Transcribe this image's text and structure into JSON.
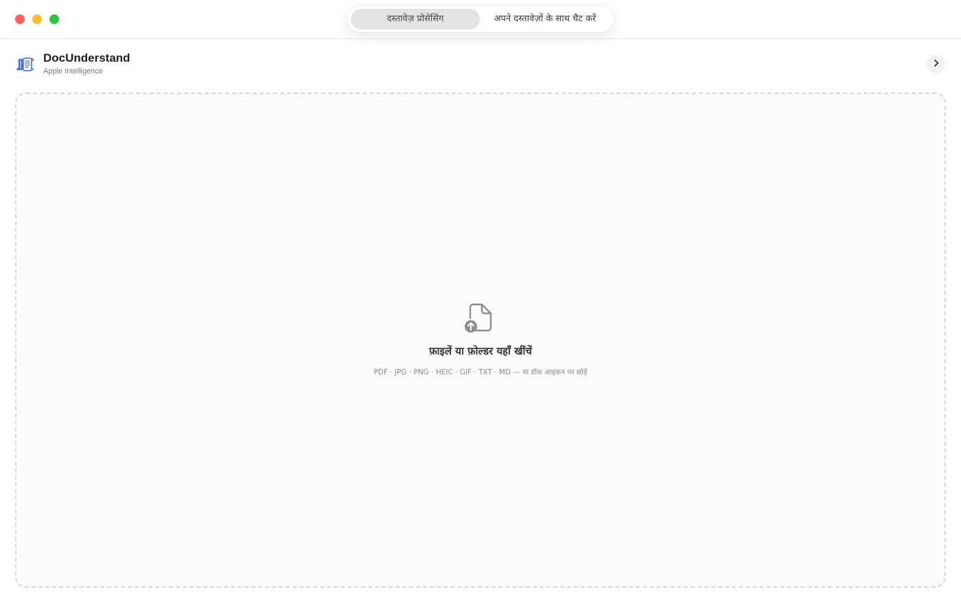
{
  "window": {
    "controls": {
      "close": "close",
      "minimize": "minimize",
      "maximize": "maximize"
    }
  },
  "tabs": [
    {
      "label": "दस्तावेज़ प्रोसेसिंग",
      "active": true
    },
    {
      "label": "अपने दस्तावेज़ों के साथ चैट करें",
      "active": false
    }
  ],
  "app": {
    "name": "DocUnderstand",
    "subtitle": "Apple Intelligence",
    "icon": "document-app-icon",
    "forward_icon": "chevron-right-icon"
  },
  "dropzone": {
    "icon": "document-upload-icon",
    "title": "फ़ाइलें या फ़ोल्डर यहाँ खींचें",
    "formats": "PDF · JPG · PNG · HEIC · GIF · TXT · MD — या डॉक आइकन पर छोड़ें"
  },
  "colors": {
    "close": "#ff5f57",
    "minimize": "#febc2e",
    "maximize": "#28c840",
    "active_tab_bg": "#e3e3e3",
    "dropzone_border": "#d6d6d6"
  }
}
